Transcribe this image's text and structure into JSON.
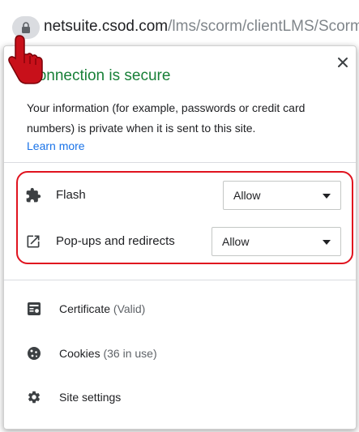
{
  "address_bar": {
    "host": "netsuite.csod.com",
    "path": "/lms/scorm/clientLMS/Scorm"
  },
  "popup": {
    "title": "Connection is secure",
    "info": "Your information (for example, passwords or credit card numbers) is private when it is sent to this site.",
    "learn_more": "Learn more",
    "permissions": [
      {
        "icon": "puzzle-piece-icon",
        "label": "Flash",
        "value": "Allow"
      },
      {
        "icon": "external-link-icon",
        "label": "Pop-ups and redirects",
        "value": "Allow"
      }
    ],
    "menu": [
      {
        "icon": "certificate-icon",
        "label": "Certificate",
        "detail": "(Valid)"
      },
      {
        "icon": "cookie-icon",
        "label": "Cookies",
        "detail": "(36 in use)"
      },
      {
        "icon": "gear-icon",
        "label": "Site settings",
        "detail": ""
      }
    ]
  },
  "colors": {
    "secure_green": "#188038",
    "link_blue": "#1a73e8",
    "highlight_red": "#e0131f"
  }
}
